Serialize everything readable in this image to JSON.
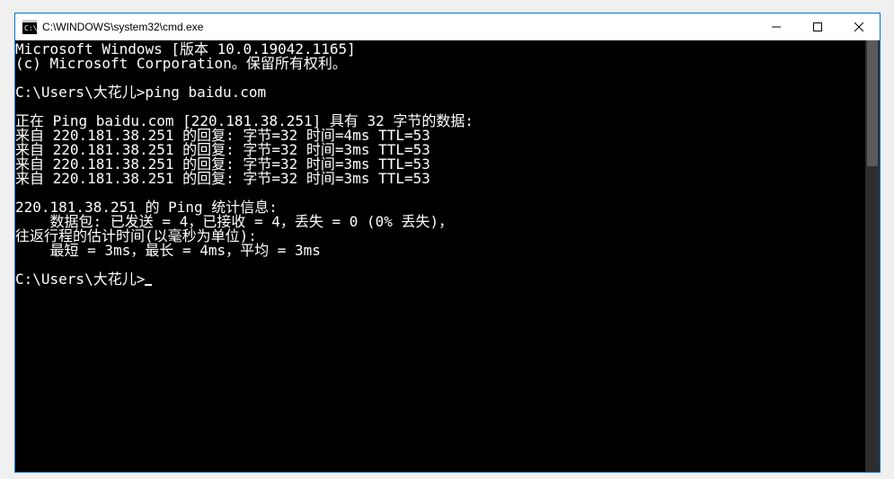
{
  "window": {
    "title": "C:\\WINDOWS\\system32\\cmd.exe"
  },
  "terminal": {
    "header1": "Microsoft Windows [版本 10.0.19042.1165]",
    "header2": "(c) Microsoft Corporation。保留所有权利。",
    "prompt1": "C:\\Users\\大花儿>ping baidu.com",
    "pingHeader": "正在 Ping baidu.com [220.181.38.251] 具有 32 字节的数据:",
    "reply1": "来自 220.181.38.251 的回复: 字节=32 时间=4ms TTL=53",
    "reply2": "来自 220.181.38.251 的回复: 字节=32 时间=3ms TTL=53",
    "reply3": "来自 220.181.38.251 的回复: 字节=32 时间=3ms TTL=53",
    "reply4": "来自 220.181.38.251 的回复: 字节=32 时间=3ms TTL=53",
    "statsHeader": "220.181.38.251 的 Ping 统计信息:",
    "statsPackets": "    数据包: 已发送 = 4，已接收 = 4，丢失 = 0 (0% 丢失)，",
    "rttHeader": "往返行程的估计时间(以毫秒为单位):",
    "rttValues": "    最短 = 3ms，最长 = 4ms，平均 = 3ms",
    "prompt2": "C:\\Users\\大花儿>"
  }
}
